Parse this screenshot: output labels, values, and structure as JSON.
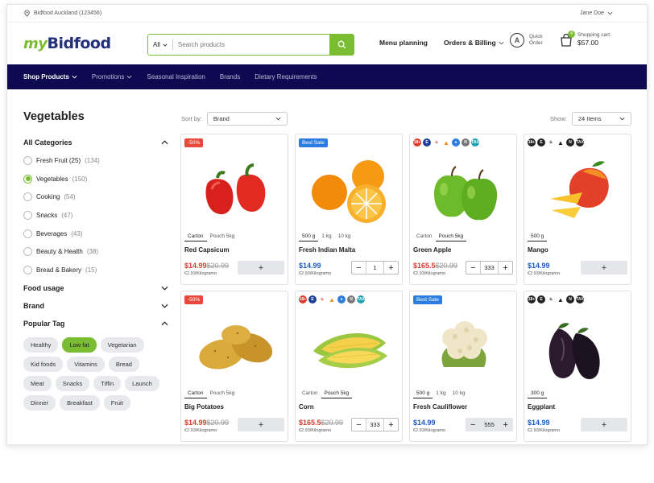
{
  "topbar": {
    "location": "Bidfood Auckland (123456)",
    "user": "Jane Doe"
  },
  "logo": {
    "prefix": "my",
    "name": "Bidfood"
  },
  "search": {
    "scope": "All",
    "placeholder": "Search products"
  },
  "header_nav": {
    "menu_planning": "Menu planning",
    "orders_billing": "Orders & Billing"
  },
  "quick_order": {
    "line1": "Quick",
    "line2": "Order"
  },
  "cart": {
    "label": "Shopping cart:",
    "amount": "$57.00",
    "count": "4"
  },
  "main_nav": [
    "Shop Products",
    "Promotions",
    "Seasonal Inspiration",
    "Brands",
    "Dietary Requirements"
  ],
  "page_title": "Vegetables",
  "sidebar": {
    "all_categories": "All Categories",
    "categories": [
      {
        "name": "Fresh Fruit (25)",
        "count": "(134)",
        "selected": false
      },
      {
        "name": "Vegetables",
        "count": "(150)",
        "selected": true
      },
      {
        "name": "Cooking",
        "count": "(54)",
        "selected": false
      },
      {
        "name": "Snacks",
        "count": "(47)",
        "selected": false
      },
      {
        "name": "Beverages",
        "count": "(43)",
        "selected": false
      },
      {
        "name": "Beauty & Health",
        "count": "(38)",
        "selected": false
      },
      {
        "name": "Bread & Bakery",
        "count": "(15)",
        "selected": false
      }
    ],
    "food_usage": "Food usage",
    "brand": "Brand",
    "popular_tag": "Popular Tag",
    "tags": [
      {
        "label": "Healthy",
        "active": false
      },
      {
        "label": "Low fat",
        "active": true
      },
      {
        "label": "Vegetarian",
        "active": false
      },
      {
        "label": "Kid foods",
        "active": false
      },
      {
        "label": "Vitamins",
        "active": false
      },
      {
        "label": "Bread",
        "active": false
      },
      {
        "label": "Meat",
        "active": false
      },
      {
        "label": "Snacks",
        "active": false
      },
      {
        "label": "Tiffin",
        "active": false
      },
      {
        "label": "Launch",
        "active": false
      },
      {
        "label": "Dinner",
        "active": false
      },
      {
        "label": "Breakfast",
        "active": false
      },
      {
        "label": "Fruit",
        "active": false
      }
    ]
  },
  "sort": {
    "label": "Sort by:",
    "value": "Brand"
  },
  "show": {
    "label": "Show:",
    "value": "24 Items"
  },
  "products": [
    {
      "name": "Red Capsicum",
      "badge": "-50%",
      "badge_type": "sale",
      "units": [
        "Carton",
        "Pouch 5kg"
      ],
      "active_unit": 0,
      "price": "$14.99",
      "old_price": "$20.99",
      "price_color": "red",
      "per_kg": "€2.93/Kilogramo",
      "control": "add",
      "qty": ""
    },
    {
      "name": "Fresh Indian Malta",
      "badge": "Best Sale",
      "badge_type": "best",
      "units": [
        "500 g",
        "1 kg",
        "10 kg"
      ],
      "active_unit": 0,
      "price": "$14.99",
      "old_price": "",
      "price_color": "blue",
      "per_kg": "€2.93/Kilogramo",
      "control": "stepper",
      "qty": "1"
    },
    {
      "name": "Green Apple",
      "badge": "",
      "badge_type": "icons",
      "units": [
        "Carton",
        "Pouch 5kg"
      ],
      "active_unit": 1,
      "price": "$165.5",
      "old_price": "$20.99",
      "price_color": "red",
      "per_kg": "€2.93/Kilogramo",
      "control": "stepper",
      "qty": "333"
    },
    {
      "name": "Mango",
      "badge": "",
      "badge_type": "icons-dark",
      "units": [
        "500 g"
      ],
      "active_unit": 0,
      "price": "$14.99",
      "old_price": "",
      "price_color": "blue",
      "per_kg": "€2.93/Kilogramo",
      "control": "add",
      "qty": ""
    },
    {
      "name": "Big Potatoes",
      "badge": "-50%",
      "badge_type": "sale",
      "units": [
        "Carton",
        "Pouch 5kg"
      ],
      "active_unit": 0,
      "price": "$14.99",
      "old_price": "$20.99",
      "price_color": "red",
      "per_kg": "€2.93/Kilogramo",
      "control": "add",
      "qty": ""
    },
    {
      "name": "Corn",
      "badge": "",
      "badge_type": "icons",
      "units": [
        "Carton",
        "Pouch 5kg"
      ],
      "active_unit": 1,
      "price": "$165.5",
      "old_price": "$20.99",
      "price_color": "red",
      "per_kg": "€2.93/Kilogramo",
      "control": "stepper",
      "qty": "333"
    },
    {
      "name": "Fresh Cauliflower",
      "badge": "Best Sale",
      "badge_type": "best",
      "units": [
        "500 g",
        "1 kg",
        "10 kg"
      ],
      "active_unit": 0,
      "price": "$14.99",
      "old_price": "",
      "price_color": "blue",
      "per_kg": "€2.93/Kilogramo",
      "control": "stepper-grey",
      "qty": "555"
    },
    {
      "name": "Eggplant",
      "badge": "",
      "badge_type": "icons-dark",
      "units": [
        "300 g"
      ],
      "active_unit": 0,
      "price": "$14.99",
      "old_price": "",
      "price_color": "blue",
      "per_kg": "€2.93/Kilogramo",
      "control": "add",
      "qty": ""
    }
  ],
  "diet_icons": [
    "18+",
    "E",
    "hot",
    "warn",
    "leaf",
    "N",
    "TAX"
  ],
  "diet_icon_texts": {
    "age": "18+",
    "e": "E",
    "n": "N",
    "tax": "TAX"
  },
  "colors": {
    "brand_green": "#7bbd32",
    "nav_bg": "#0e0a52",
    "sale_red": "#e74a3b",
    "best_blue": "#2d7de0",
    "price_red": "#d63b2e",
    "price_blue": "#1a5bbf"
  }
}
